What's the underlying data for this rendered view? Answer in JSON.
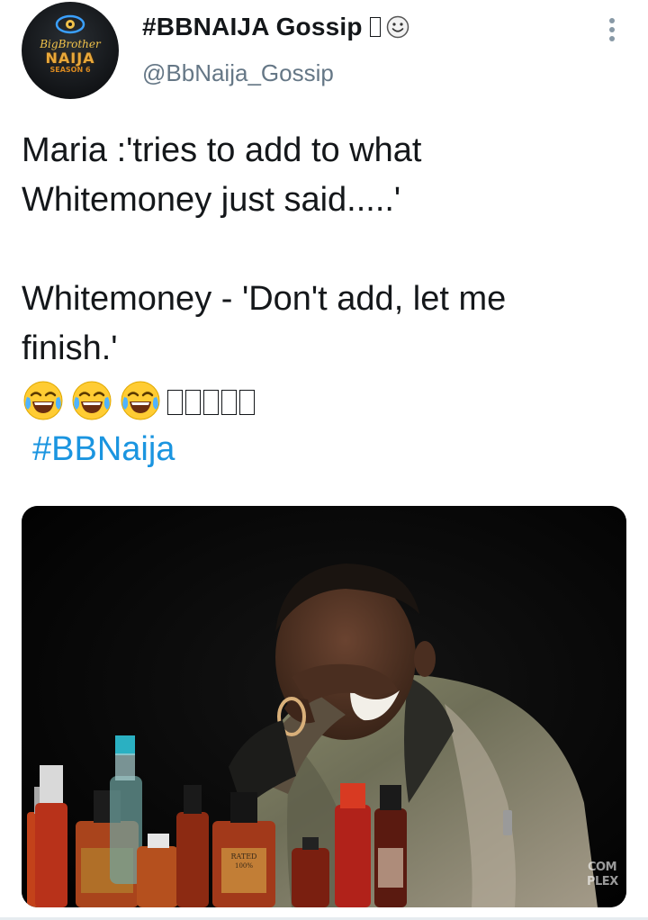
{
  "tweet": {
    "author": {
      "display_name": "#BBNAIJA Gossip",
      "handle": "@BbNaija_Gossip",
      "avatar_text": [
        "BigBrother",
        "NAIJA",
        "SEASON 6"
      ]
    },
    "body_lines": "Maria :'tries to add to what\nWhitemoney just said.....'\n\nWhitemoney - 'Don't add, let me\nfinish.'",
    "emoji": [
      "face-with-tears-of-joy",
      "face-with-tears-of-joy",
      "face-with-tears-of-joy"
    ],
    "unrendered_glyph_count": 5,
    "hashtag": "#BBNaija",
    "media": {
      "watermark": "COM\nPLEX",
      "bottle_label": "RATED\n100%"
    }
  },
  "colors": {
    "text": "#14171a",
    "secondary": "#657786",
    "link": "#1b95e0",
    "media_bg": "#050505"
  }
}
